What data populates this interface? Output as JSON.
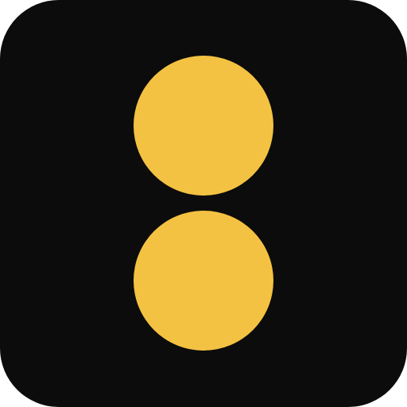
{
  "icon": {
    "name": "two-dot-app-icon",
    "background_color": "#0c0c0c",
    "dot_color": "#f4c242",
    "dots": [
      "top",
      "bottom"
    ]
  }
}
